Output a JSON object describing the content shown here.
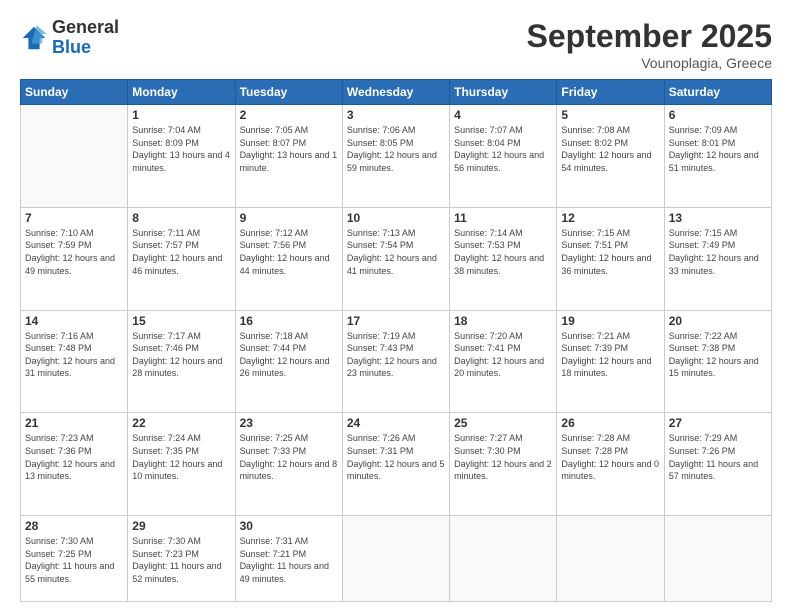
{
  "logo": {
    "general": "General",
    "blue": "Blue"
  },
  "header": {
    "month": "September 2025",
    "location": "Vounoplagia, Greece"
  },
  "weekdays": [
    "Sunday",
    "Monday",
    "Tuesday",
    "Wednesday",
    "Thursday",
    "Friday",
    "Saturday"
  ],
  "weeks": [
    [
      null,
      {
        "day": 1,
        "sunrise": "7:04 AM",
        "sunset": "8:09 PM",
        "daylight": "13 hours and 4 minutes."
      },
      {
        "day": 2,
        "sunrise": "7:05 AM",
        "sunset": "8:07 PM",
        "daylight": "13 hours and 1 minute."
      },
      {
        "day": 3,
        "sunrise": "7:06 AM",
        "sunset": "8:05 PM",
        "daylight": "12 hours and 59 minutes."
      },
      {
        "day": 4,
        "sunrise": "7:07 AM",
        "sunset": "8:04 PM",
        "daylight": "12 hours and 56 minutes."
      },
      {
        "day": 5,
        "sunrise": "7:08 AM",
        "sunset": "8:02 PM",
        "daylight": "12 hours and 54 minutes."
      },
      {
        "day": 6,
        "sunrise": "7:09 AM",
        "sunset": "8:01 PM",
        "daylight": "12 hours and 51 minutes."
      }
    ],
    [
      {
        "day": 7,
        "sunrise": "7:10 AM",
        "sunset": "7:59 PM",
        "daylight": "12 hours and 49 minutes."
      },
      {
        "day": 8,
        "sunrise": "7:11 AM",
        "sunset": "7:57 PM",
        "daylight": "12 hours and 46 minutes."
      },
      {
        "day": 9,
        "sunrise": "7:12 AM",
        "sunset": "7:56 PM",
        "daylight": "12 hours and 44 minutes."
      },
      {
        "day": 10,
        "sunrise": "7:13 AM",
        "sunset": "7:54 PM",
        "daylight": "12 hours and 41 minutes."
      },
      {
        "day": 11,
        "sunrise": "7:14 AM",
        "sunset": "7:53 PM",
        "daylight": "12 hours and 38 minutes."
      },
      {
        "day": 12,
        "sunrise": "7:15 AM",
        "sunset": "7:51 PM",
        "daylight": "12 hours and 36 minutes."
      },
      {
        "day": 13,
        "sunrise": "7:15 AM",
        "sunset": "7:49 PM",
        "daylight": "12 hours and 33 minutes."
      }
    ],
    [
      {
        "day": 14,
        "sunrise": "7:16 AM",
        "sunset": "7:48 PM",
        "daylight": "12 hours and 31 minutes."
      },
      {
        "day": 15,
        "sunrise": "7:17 AM",
        "sunset": "7:46 PM",
        "daylight": "12 hours and 28 minutes."
      },
      {
        "day": 16,
        "sunrise": "7:18 AM",
        "sunset": "7:44 PM",
        "daylight": "12 hours and 26 minutes."
      },
      {
        "day": 17,
        "sunrise": "7:19 AM",
        "sunset": "7:43 PM",
        "daylight": "12 hours and 23 minutes."
      },
      {
        "day": 18,
        "sunrise": "7:20 AM",
        "sunset": "7:41 PM",
        "daylight": "12 hours and 20 minutes."
      },
      {
        "day": 19,
        "sunrise": "7:21 AM",
        "sunset": "7:39 PM",
        "daylight": "12 hours and 18 minutes."
      },
      {
        "day": 20,
        "sunrise": "7:22 AM",
        "sunset": "7:38 PM",
        "daylight": "12 hours and 15 minutes."
      }
    ],
    [
      {
        "day": 21,
        "sunrise": "7:23 AM",
        "sunset": "7:36 PM",
        "daylight": "12 hours and 13 minutes."
      },
      {
        "day": 22,
        "sunrise": "7:24 AM",
        "sunset": "7:35 PM",
        "daylight": "12 hours and 10 minutes."
      },
      {
        "day": 23,
        "sunrise": "7:25 AM",
        "sunset": "7:33 PM",
        "daylight": "12 hours and 8 minutes."
      },
      {
        "day": 24,
        "sunrise": "7:26 AM",
        "sunset": "7:31 PM",
        "daylight": "12 hours and 5 minutes."
      },
      {
        "day": 25,
        "sunrise": "7:27 AM",
        "sunset": "7:30 PM",
        "daylight": "12 hours and 2 minutes."
      },
      {
        "day": 26,
        "sunrise": "7:28 AM",
        "sunset": "7:28 PM",
        "daylight": "12 hours and 0 minutes."
      },
      {
        "day": 27,
        "sunrise": "7:29 AM",
        "sunset": "7:26 PM",
        "daylight": "11 hours and 57 minutes."
      }
    ],
    [
      {
        "day": 28,
        "sunrise": "7:30 AM",
        "sunset": "7:25 PM",
        "daylight": "11 hours and 55 minutes."
      },
      {
        "day": 29,
        "sunrise": "7:30 AM",
        "sunset": "7:23 PM",
        "daylight": "11 hours and 52 minutes."
      },
      {
        "day": 30,
        "sunrise": "7:31 AM",
        "sunset": "7:21 PM",
        "daylight": "11 hours and 49 minutes."
      },
      null,
      null,
      null,
      null
    ]
  ]
}
